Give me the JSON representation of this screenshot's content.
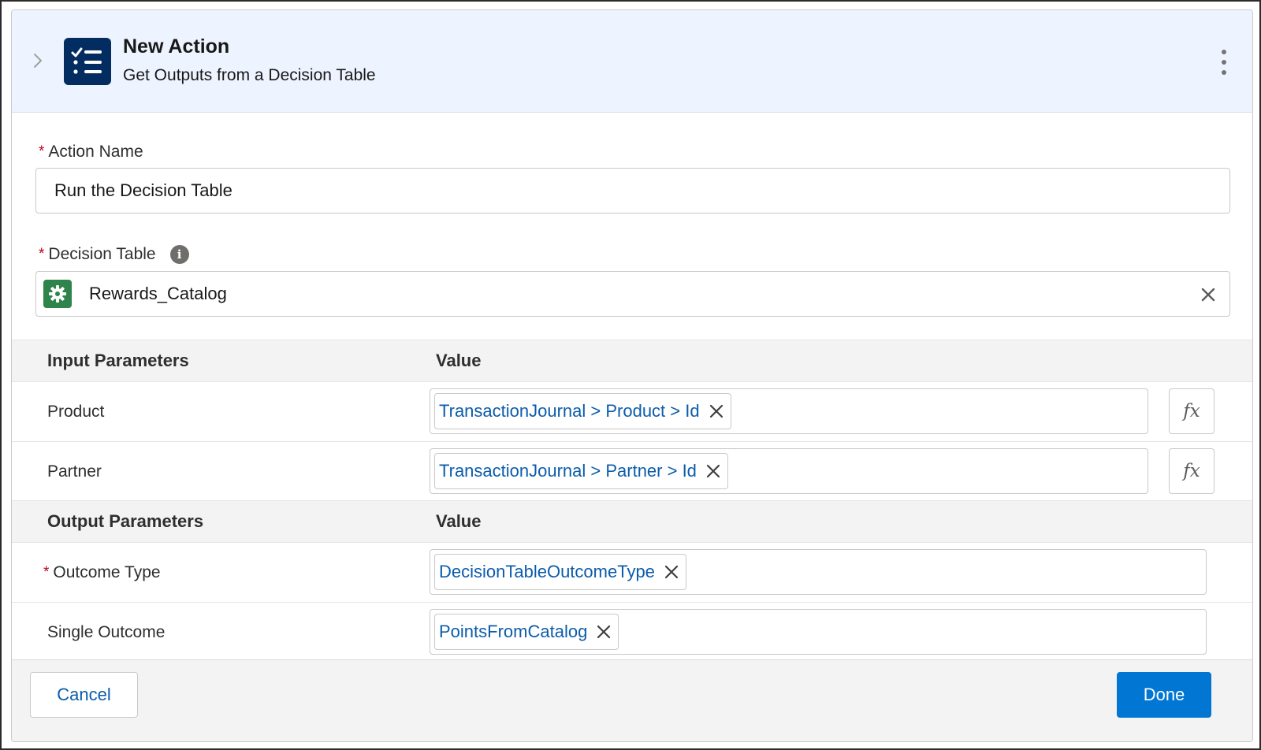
{
  "header": {
    "title": "New Action",
    "subtitle": "Get Outputs from a Decision Table",
    "icon": "checklist-icon",
    "accent_color": "#032d60"
  },
  "fields": {
    "action_name": {
      "label": "Action Name",
      "required": "*",
      "value": "Run the Decision Table"
    },
    "decision_table": {
      "label": "Decision Table",
      "required": "*",
      "value": "Rewards_Catalog",
      "icon": "gear-icon",
      "icon_color": "#2e844a"
    }
  },
  "input_parameters": {
    "header": "Input Parameters",
    "value_header": "Value",
    "rows": [
      {
        "label": "Product",
        "value": "TransactionJournal > Product > Id",
        "fx": "fx"
      },
      {
        "label": "Partner",
        "value": "TransactionJournal > Partner > Id",
        "fx": "fx"
      }
    ]
  },
  "output_parameters": {
    "header": "Output Parameters",
    "value_header": "Value",
    "rows": [
      {
        "label": "Outcome Type",
        "required": "*",
        "value": "DecisionTableOutcomeType"
      },
      {
        "label": "Single Outcome",
        "value": "PointsFromCatalog"
      }
    ]
  },
  "footer": {
    "cancel_label": "Cancel",
    "done_label": "Done",
    "brand_color": "#0176d3"
  }
}
